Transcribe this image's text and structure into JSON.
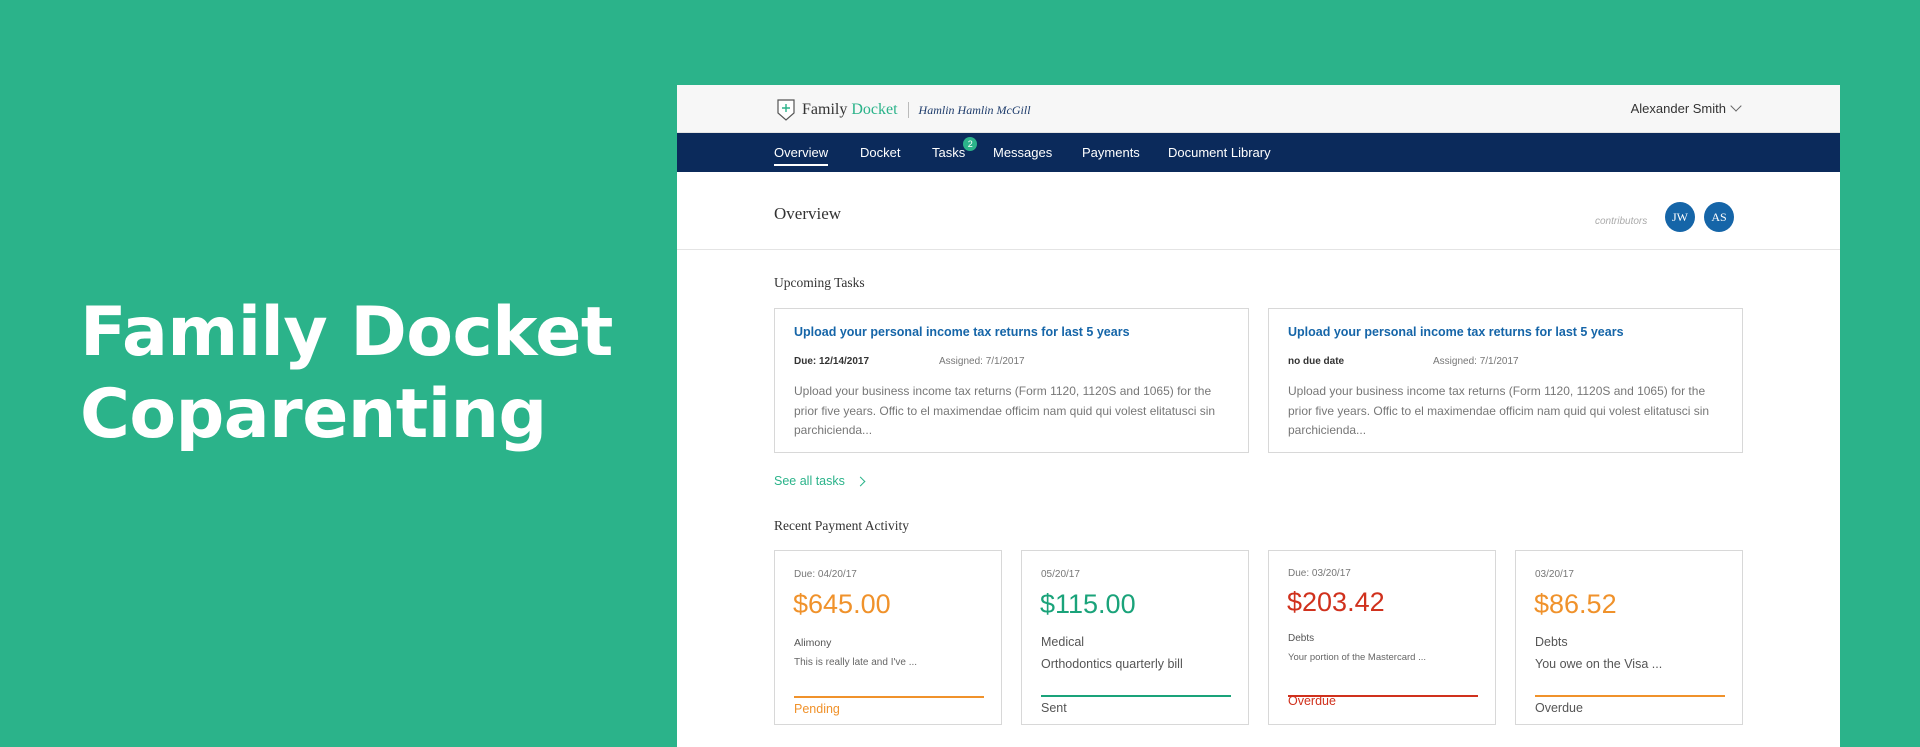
{
  "hero": {
    "line1": "Family Docket",
    "line2": "Coparenting"
  },
  "brand": {
    "name": "Family",
    "accent": "Docket",
    "firm": "Hamlin Hamlin McGill"
  },
  "user": {
    "name": "Alexander Smith"
  },
  "nav": {
    "items": [
      "Overview",
      "Docket",
      "Tasks",
      "Messages",
      "Payments",
      "Document Library"
    ],
    "tasks_badge": "2"
  },
  "overview": {
    "title": "Overview",
    "contributors_label": "contributors",
    "avatars": [
      "JW",
      "AS"
    ]
  },
  "tasks": {
    "section_title": "Upcoming Tasks",
    "cards": [
      {
        "title": "Upload your personal income tax returns for last 5 years",
        "due": "Due: 12/14/2017",
        "assigned": "Assigned: 7/1/2017",
        "description": "Upload your business income tax returns (Form 1120, 1120S and 1065) for the prior five years. Offic to el maximendae officim nam quid qui volest elitatusci sin parchicienda..."
      },
      {
        "title": "Upload your personal income tax returns for last 5 years",
        "due": "no due date",
        "assigned": "Assigned: 7/1/2017",
        "description": "Upload your business income tax returns (Form 1120, 1120S and 1065) for the prior five years. Offic to el maximendae officim nam quid qui volest elitatusci sin parchicienda..."
      }
    ],
    "see_all": "See all tasks"
  },
  "payments": {
    "section_title": "Recent Payment Activity",
    "cards": [
      {
        "date": "Due: 04/20/17",
        "amount": "$645.00",
        "category": "Alimony",
        "description": "This is really late and I've ...",
        "status": "Pending",
        "color": "#f0922b"
      },
      {
        "date": "05/20/17",
        "amount": "$115.00",
        "category": "Medical",
        "description": "Orthodontics quarterly bill",
        "status": "Sent",
        "color": "#1aa37a"
      },
      {
        "date": "Due: 03/20/17",
        "amount": "$203.42",
        "category": "Debts",
        "description": "Your portion of the Mastercard ...",
        "status": "Overdue",
        "color": "#d0311d"
      },
      {
        "date": "03/20/17",
        "amount": "$86.52",
        "category": "Debts",
        "description": "You owe on the Visa ...",
        "status": "Overdue",
        "color": "#f0922b"
      }
    ]
  },
  "colors": {
    "background": "#2bb38a",
    "nav": "#0b2a5b",
    "link": "#1565a8",
    "accent": "#2bb38a"
  },
  "icons": [
    "logo-icon",
    "chevron-down-icon",
    "chevron-right-icon"
  ]
}
